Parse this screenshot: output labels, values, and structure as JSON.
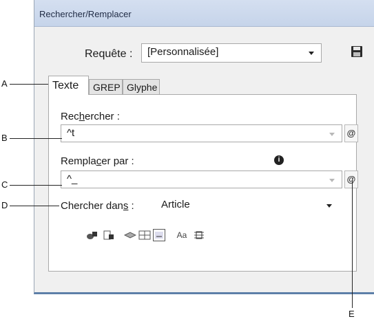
{
  "window": {
    "title": "Rechercher/Remplacer"
  },
  "query": {
    "label": "Requête :",
    "value": "[Personnalisée]"
  },
  "tabs": [
    {
      "label": "Texte"
    },
    {
      "label": "GREP"
    },
    {
      "label": "Glyphe"
    }
  ],
  "find": {
    "label_pre": "Rec",
    "label_u": "h",
    "label_post": "ercher :",
    "value": "^t"
  },
  "replace": {
    "label_pre": "Rempla",
    "label_u": "c",
    "label_post": "er par :",
    "value": "^_"
  },
  "search_in": {
    "label_pre": "Chercher dan",
    "label_u": "s",
    "label_post": " :",
    "value": "Article"
  },
  "special_char_button": "@",
  "options": [
    {
      "icon": "locked-layers-icon"
    },
    {
      "icon": "locked-stories-icon"
    },
    {
      "icon": "hidden-layers-icon"
    },
    {
      "icon": "master-pages-icon"
    },
    {
      "icon": "footnotes-icon"
    },
    {
      "icon": "case-sensitive-icon",
      "label": "Aa"
    },
    {
      "icon": "whole-word-icon"
    }
  ],
  "callouts": [
    "A",
    "B",
    "C",
    "D",
    "E"
  ]
}
